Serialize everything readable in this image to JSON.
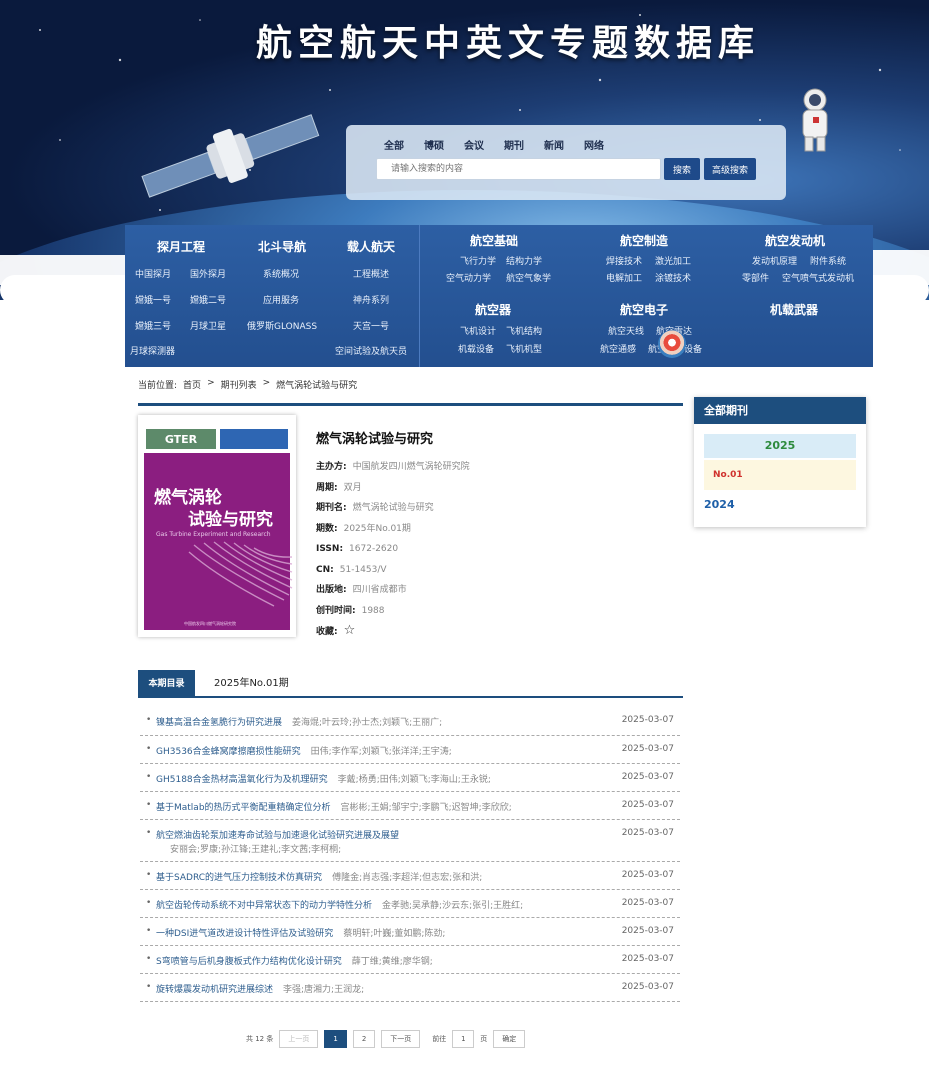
{
  "banner": {
    "title": "航空航天中英文专题数据库"
  },
  "search": {
    "tabs": [
      "全部",
      "博硕",
      "会议",
      "期刊",
      "新闻",
      "网络"
    ],
    "placeholder": "请输入搜索的内容",
    "search_label": "搜索",
    "advanced_label": "高级搜索"
  },
  "nav": {
    "left": {
      "headers": [
        "探月工程",
        "北斗导航",
        "载人航天"
      ],
      "links": [
        "中国探月",
        "国外探月",
        "系统概况",
        "工程概述",
        "嫦娥一号",
        "嫦娥二号",
        "应用服务",
        "神舟系列",
        "嫦娥三号",
        "月球卫星",
        "俄罗斯GLONASS",
        "天宫一号",
        "月球探测器",
        "空间试验及航天员"
      ]
    },
    "right": {
      "headers": [
        "航空基础",
        "航空制造",
        "航空发动机",
        "航空器",
        "航空电子",
        "机载武器"
      ],
      "links": [
        "飞行力学",
        "结构力学",
        "焊接技术",
        "激光加工",
        "发动机原理",
        "附件系统",
        "空气动力学",
        "航空气象学",
        "电解加工",
        "涂镀技术",
        "零部件",
        "空气喷气式发动机",
        "飞机设计",
        "飞机结构",
        "航空天线",
        "航空雷达",
        "机载设备",
        "飞机机型",
        "航空通感",
        "航空通信设备"
      ]
    }
  },
  "breadcrumb": {
    "label": "当前位置:",
    "items": [
      "首页",
      ">",
      "期刊列表",
      ">",
      "燃气涡轮试验与研究"
    ]
  },
  "cover": {
    "logo": "GTER",
    "title_line1": "燃气涡轮",
    "title_line2": "试验与研究",
    "subtitle": "Gas Turbine Experiment and Research",
    "footer": "中国航发四川燃气涡轮研究院"
  },
  "journal": {
    "title": "燃气涡轮试验与研究",
    "fields": [
      {
        "label": "主办方:",
        "value": "中国航发四川燃气涡轮研究院"
      },
      {
        "label": "周期:",
        "value": "双月"
      },
      {
        "label": "期刊名:",
        "value": "燃气涡轮试验与研究"
      },
      {
        "label": "期数:",
        "value": "2025年No.01期"
      },
      {
        "label": "ISSN:",
        "value": "1672-2620"
      },
      {
        "label": "CN:",
        "value": "51-1453/V"
      },
      {
        "label": "出版地:",
        "value": "四川省成都市"
      },
      {
        "label": "创刊时间:",
        "value": "1988"
      },
      {
        "label": "收藏:",
        "value": ""
      }
    ]
  },
  "sidebar": {
    "title": "全部期刊",
    "year_active": "2025",
    "issue": "No.01",
    "year_other": "2024"
  },
  "toc": {
    "tab_active": "本期目录",
    "tab_issue": "2025年No.01期",
    "articles": [
      {
        "title": "镍基高温合金氢脆行为研究进展",
        "authors": "姜海焜;叶云玲;孙士杰;刘颖飞;王丽广;",
        "date": "2025-03-07"
      },
      {
        "title": "GH3536合金蜂窝摩擦磨损性能研究",
        "authors": "田伟;李作军;刘颖飞;张洋洋;王宇涛;",
        "date": "2025-03-07"
      },
      {
        "title": "GH5188合金热材高温氧化行为及机理研究",
        "authors": "李戴;杨勇;田伟;刘颖飞;李海山;王永锐;",
        "date": "2025-03-07"
      },
      {
        "title": "基于Matlab的热历式平衡配重精确定位分析",
        "authors": "宫彬彬;王娟;邹宇宁;李鹏飞;迟智坤;李欣欣;",
        "date": "2025-03-07"
      },
      {
        "title": "航空燃油齿轮泵加速寿命试验与加速退化试验研究进展及展望",
        "authors": "安丽会;罗康;孙江锋;王建礼;李文茜;李柯桐;",
        "date": "2025-03-07"
      },
      {
        "title": "基于SADRC的进气压力控制技术仿真研究",
        "authors": "傅隆金;肖志强;李超洋;但志宏;张和洪;",
        "date": "2025-03-07"
      },
      {
        "title": "航空齿轮传动系统不对中异常状态下的动力学特性分析",
        "authors": "金孝驰;吴承静;沙云东;张引;王胜红;",
        "date": "2025-03-07"
      },
      {
        "title": "一种DSI进气道改进设计特性评估及试验研究",
        "authors": "蔡明轩;叶巍;董如鹏;陈劲;",
        "date": "2025-03-07"
      },
      {
        "title": "S弯喷管与后机身腹板式作力结构优化设计研究",
        "authors": "薛丁维;黄维;廖华钢;",
        "date": "2025-03-07"
      },
      {
        "title": "旋转爆震发动机研究进展综述",
        "authors": "李强;唐湘力;王润龙;",
        "date": "2025-03-07"
      }
    ]
  },
  "pager": {
    "total": "共 12 条",
    "prev": "上一页",
    "pages": [
      "1",
      "2"
    ],
    "next": "下一页",
    "goto_label": "前往",
    "page_value": "1",
    "page_unit": "页",
    "confirm": "确定"
  }
}
